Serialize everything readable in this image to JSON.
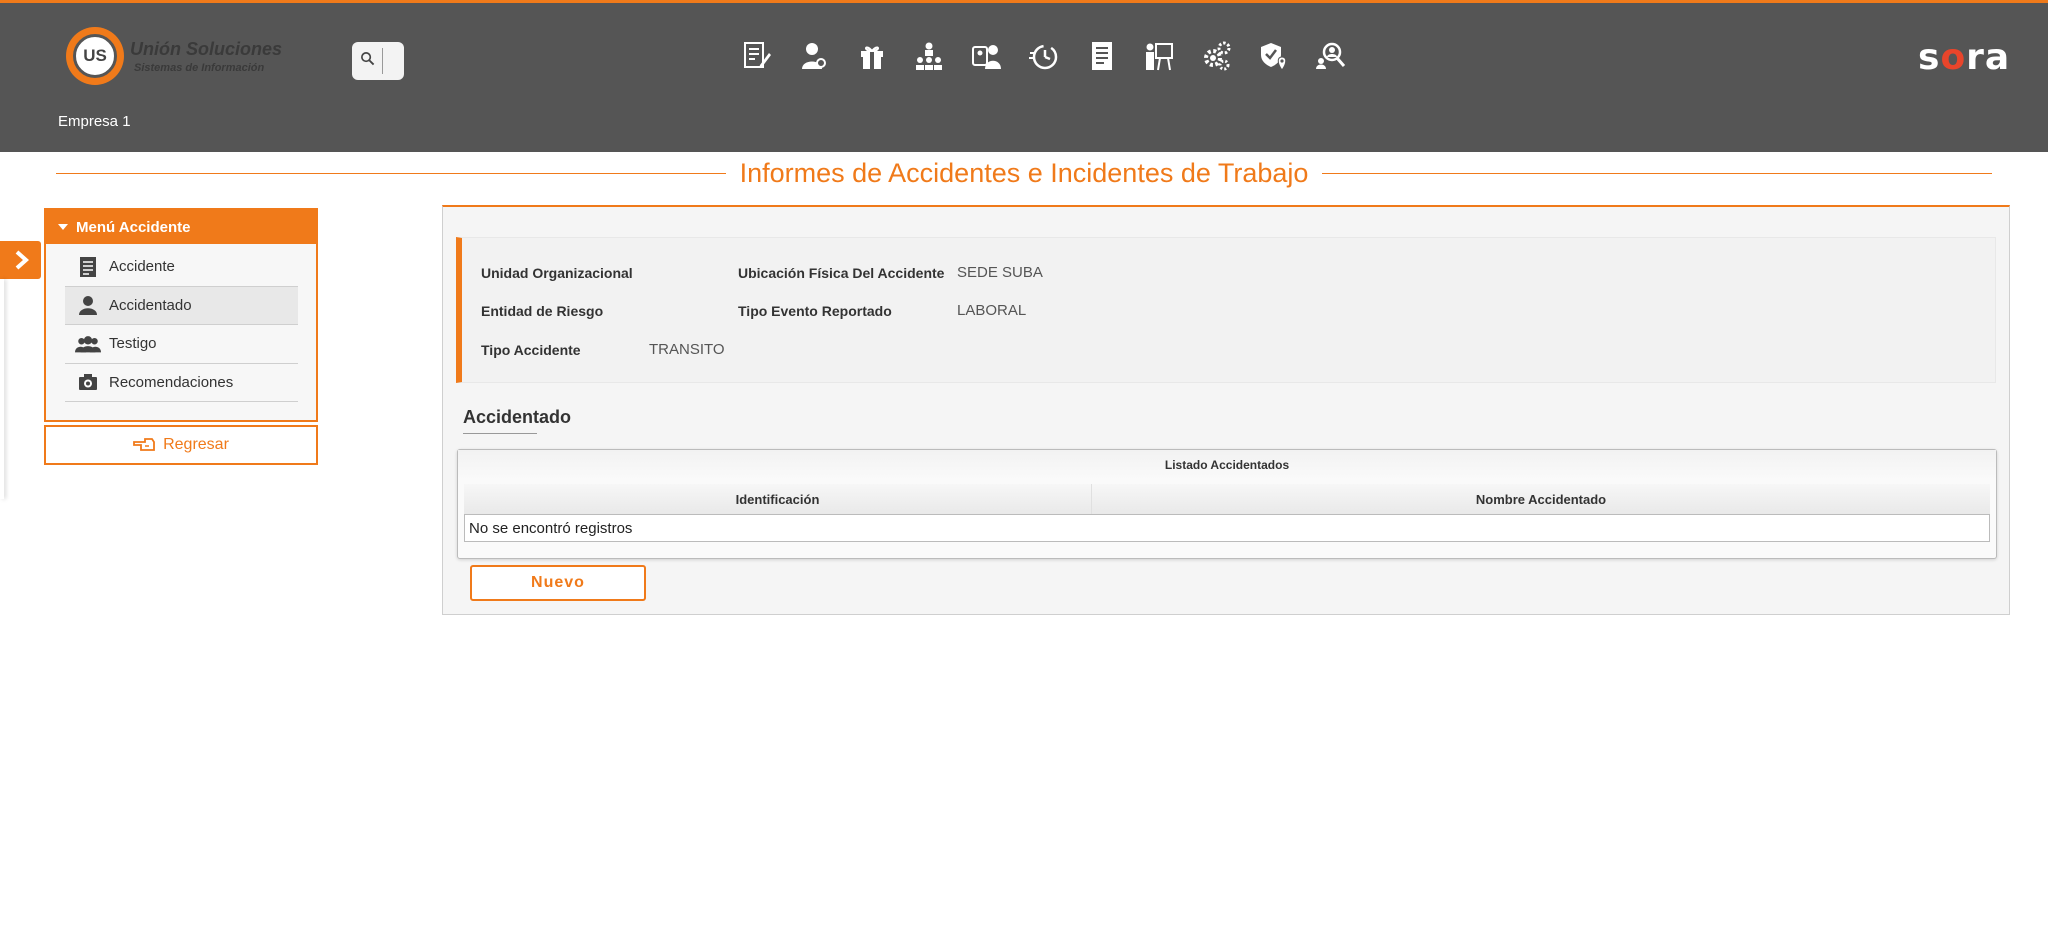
{
  "header": {
    "logo_title": "Unión Soluciones",
    "logo_subtitle": "Sistemas de Información",
    "logo_mark": "US",
    "search_value": "",
    "brand": "sora",
    "company": "Empresa 1",
    "nav_icons": [
      "document-edit-icon",
      "user-settings-icon",
      "gift-icon",
      "org-chart-icon",
      "id-badge-icon",
      "stopwatch-icon",
      "report-list-icon",
      "presentation-icon",
      "gears-icon",
      "shield-location-icon",
      "users-search-icon"
    ]
  },
  "page": {
    "title": "Informes de Accidentes e Incidentes de Trabajo"
  },
  "menu": {
    "header": "Menú Accidente",
    "items": [
      {
        "label": "Accidente",
        "icon": "document-icon"
      },
      {
        "label": "Accidentado",
        "icon": "user-icon"
      },
      {
        "label": "Testigo",
        "icon": "group-icon"
      },
      {
        "label": "Recomendaciones",
        "icon": "camera-icon"
      }
    ],
    "back_label": "Regresar"
  },
  "info": {
    "unidad_label": "Unidad Organizacional",
    "unidad_value": "",
    "ubicacion_label": "Ubicación Física Del Accidente",
    "ubicacion_value": "SEDE SUBA",
    "entidad_label": "Entidad de Riesgo",
    "entidad_value": "",
    "evento_label": "Tipo Evento Reportado",
    "evento_value": "LABORAL",
    "tipo_label": "Tipo Accidente",
    "tipo_value": "TRANSITO"
  },
  "section": {
    "title": "Accidentado"
  },
  "grid": {
    "caption": "Listado Accidentados",
    "columns": [
      "Identificación",
      "Nombre Accidentado"
    ],
    "empty_text": "No se encontró registros"
  },
  "actions": {
    "new_label": "Nuevo"
  },
  "colors": {
    "accent": "#f07a1a",
    "header_bg": "#555555"
  }
}
